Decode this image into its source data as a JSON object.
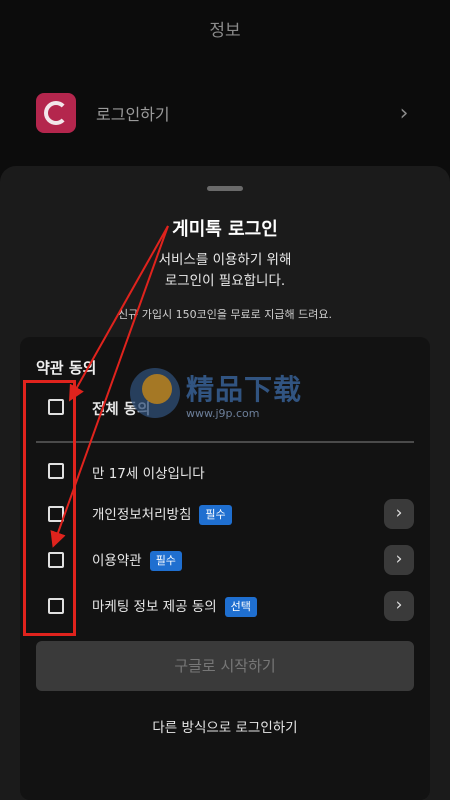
{
  "header": {
    "title": "정보"
  },
  "login_row": {
    "label": "로그인하기"
  },
  "sheet": {
    "title": "게미톡 로그인",
    "subtitle_line1": "서비스를 이용하기 위해",
    "subtitle_line2": "로그인이 필요합니다.",
    "note": "신규 가입시 150코인을 무료로 지급해 드려요."
  },
  "terms": {
    "title": "약관 동의",
    "all_label": "전체 동의",
    "items": [
      {
        "label": "만 17세 이상입니다",
        "badge": ""
      },
      {
        "label": "개인정보처리방침",
        "badge": "필수"
      },
      {
        "label": "이용약관",
        "badge": "필수"
      },
      {
        "label": "마케팅 정보 제공 동의",
        "badge": "선택"
      }
    ]
  },
  "actions": {
    "google_button": "구글로 시작하기",
    "other_login": "다른 방식으로 로그인하기"
  },
  "watermark": {
    "text": "精品下载",
    "url": "www.j9p.com"
  },
  "colors": {
    "required_badge": "#1f6fd0",
    "optional_badge": "#1f6fd0",
    "app_icon": "#b4264d",
    "highlight": "#e0231d"
  }
}
